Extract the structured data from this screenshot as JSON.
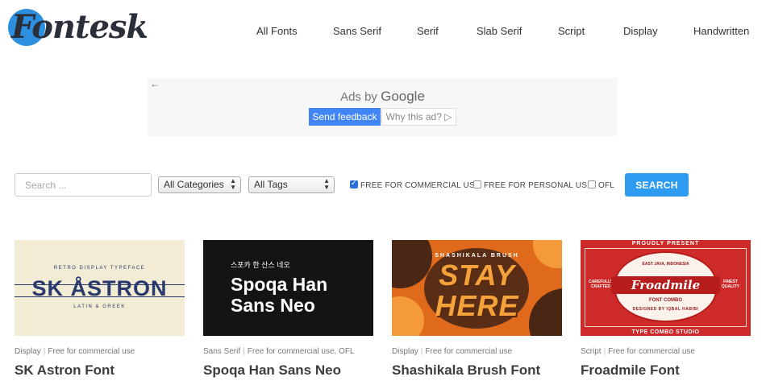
{
  "header": {
    "logo_text": "Fontesk",
    "nav": [
      {
        "label": "All Fonts"
      },
      {
        "label": "Sans Serif"
      },
      {
        "label": "Serif"
      },
      {
        "label": "Slab Serif"
      },
      {
        "label": "Script"
      },
      {
        "label": "Display"
      },
      {
        "label": "Handwritten"
      }
    ]
  },
  "ad": {
    "back_icon": "arrow-left-icon",
    "label_prefix": "Ads by",
    "label_brand": "Google",
    "feedback_button": "Send feedback",
    "why_button": "Why this ad? ▷"
  },
  "filters": {
    "search_placeholder": "Search ...",
    "categories_selected": "All Categories",
    "tags_selected": "All Tags",
    "checkboxes": [
      {
        "label": "FREE FOR COMMERCIAL USE",
        "checked": true
      },
      {
        "label": "FREE FOR PERSONAL USE",
        "checked": false
      },
      {
        "label": "OFL",
        "checked": false
      }
    ],
    "search_button": "SEARCH"
  },
  "cards": [
    {
      "category": "Display",
      "license": "Free for commercial use",
      "title": "SK Astron Font",
      "image": {
        "sub_top": "RETRO DISPLAY TYPEFACE",
        "big": "SK ÅSTRON",
        "sub_bottom": "LATIN & GREEK"
      }
    },
    {
      "category": "Sans Serif",
      "license": "Free for commercial use, OFL",
      "title": "Spoqa Han Sans Neo",
      "image": {
        "korean": "스포카 한 산스 네오",
        "line1": "Spoqa Han",
        "line2": "Sans Neo"
      }
    },
    {
      "category": "Display",
      "license": "Free for commercial use",
      "title": "Shashikala Brush Font",
      "image": {
        "sub": "SHASHIKALA BRUSH",
        "line1": "STAY",
        "line2": "HERE"
      }
    },
    {
      "category": "Script",
      "license": "Free for commercial use",
      "title": "Froadmile Font",
      "image": {
        "top": "PROUDLY PRESENT",
        "location": "EAST JAVA, INDONESIA",
        "name": "Froadmile",
        "combo": "FONT COMBO",
        "designed": "DESIGNED BY        IQBAL HABIBI",
        "left1": "CAREFULLY",
        "left2": "CRAFTED",
        "right1": "FINEST",
        "right2": "QUALITY",
        "bottom": "TYPE COMBO STUDIO"
      }
    }
  ]
}
